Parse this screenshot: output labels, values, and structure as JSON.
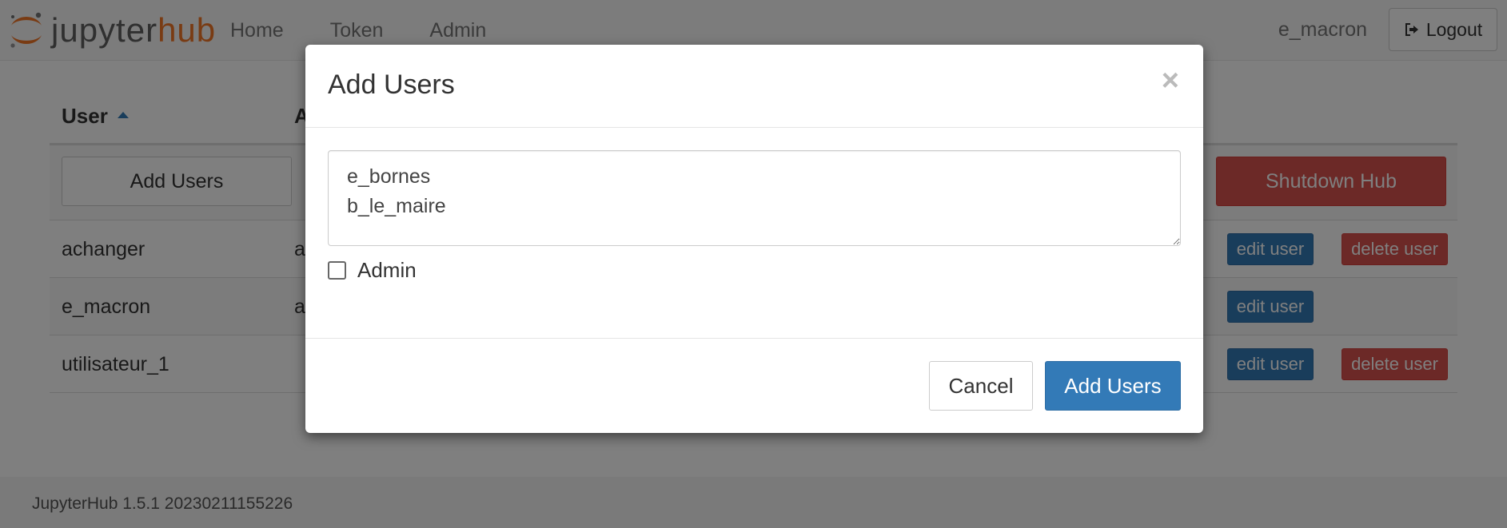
{
  "brand": {
    "name_part1": "jupyter",
    "name_part2": "hub"
  },
  "nav": {
    "links": [
      "Home",
      "Token",
      "Admin"
    ],
    "user": "e_macron",
    "logout_label": "Logout"
  },
  "table": {
    "headers": {
      "user": "User",
      "admin_partial": "A"
    },
    "add_users_label": "Add Users",
    "shutdown_label": "Shutdown Hub",
    "rows": [
      {
        "name": "achanger",
        "admin": "a",
        "edit": "edit user",
        "delete": "delete user"
      },
      {
        "name": "e_macron",
        "admin": "a",
        "edit": "edit user",
        "delete": ""
      },
      {
        "name": "utilisateur_1",
        "admin": "",
        "edit": "edit user",
        "delete": "delete user"
      }
    ]
  },
  "footer": {
    "version": "JupyterHub 1.5.1 20230211155226"
  },
  "modal": {
    "title": "Add Users",
    "close": "×",
    "usernames": "e_bornes\nb_le_maire",
    "admin_label": "Admin",
    "admin_checked": false,
    "cancel_label": "Cancel",
    "submit_label": "Add Users"
  },
  "colors": {
    "primary": "#337ab7",
    "danger": "#d9534f",
    "brand_orange": "#f37726",
    "brand_gray": "#616161"
  }
}
